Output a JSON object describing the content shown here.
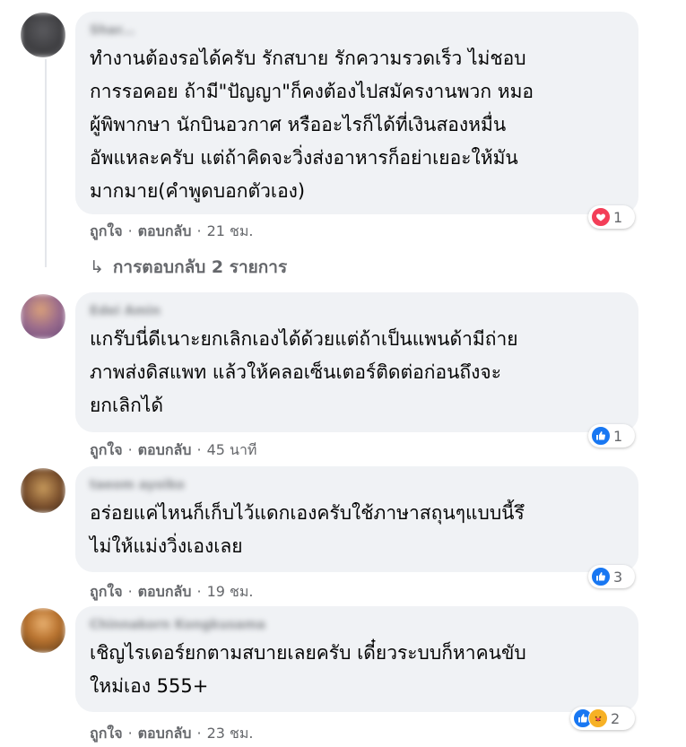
{
  "colors": {
    "like": "#1877f2",
    "love": "#f33e58",
    "care": "#f7b125",
    "bubble": "#f0f2f5",
    "meta": "#65676b"
  },
  "icons": {
    "like": "thumbs-up-icon",
    "love": "heart-icon",
    "care": "care-face-icon",
    "reply": "reply-arrow-icon"
  },
  "actions": {
    "like": "ถูกใจ",
    "reply": "ตอบกลับ",
    "separator": "·"
  },
  "comments": [
    {
      "author": "Shar...",
      "text": "ทำงานต้องรอได้ครับ รักสบาย รักความรวดเร็ว ไม่ชอบ\nการรอคอย ถ้ามี\"ปัญญา\"ก็คงต้องไปสมัครงานพวก หมอ\nผู้พิพากษา นักบินอวกาศ หรืออะไรก็ได้ที่เงินสองหมื่น\nอัพแหละครับ แต่ถ้าคิดจะวิ่งส่งอาหารก็อย่าเยอะให้มัน\nมากมาย(คำพูดบอกตัวเอง)",
      "time": "21 ชม.",
      "reaction_count": "1",
      "reactions": [
        "love"
      ],
      "replies_label": "การตอบกลับ 2 รายการ"
    },
    {
      "author": "Edei Amin",
      "text": "แกร๊บนี่ดีเนาะยกเลิกเองได้ด้วยแต่ถ้าเป็นแพนด้ามีถ่าย\nภาพส่งดิสแพท แล้วให้คลอเซ็นเตอร์ติดต่อก่อนถึงจะ\nยกเลิกได้",
      "time": "45 นาที",
      "reaction_count": "1",
      "reactions": [
        "like"
      ]
    },
    {
      "author": "taeom ayoiko",
      "text": "อร่อยแค่ไหนก็เก็บไว้แดกเองครับใช้ภาษาสถุนๆแบบนี้รึ\nไม่ให้แม่งวิ่งเองเลย",
      "time": "19 ชม.",
      "reaction_count": "3",
      "reactions": [
        "like"
      ]
    },
    {
      "author": "Chinnakorn Kongkusama",
      "text": "เชิญไรเดอร์ยกตามสบายเลยครับ เดี๋ยวระบบก็หาคนขับ\nใหม่เอง 555+",
      "time": "23 ชม.",
      "reaction_count": "2",
      "reactions": [
        "like",
        "care"
      ]
    }
  ]
}
